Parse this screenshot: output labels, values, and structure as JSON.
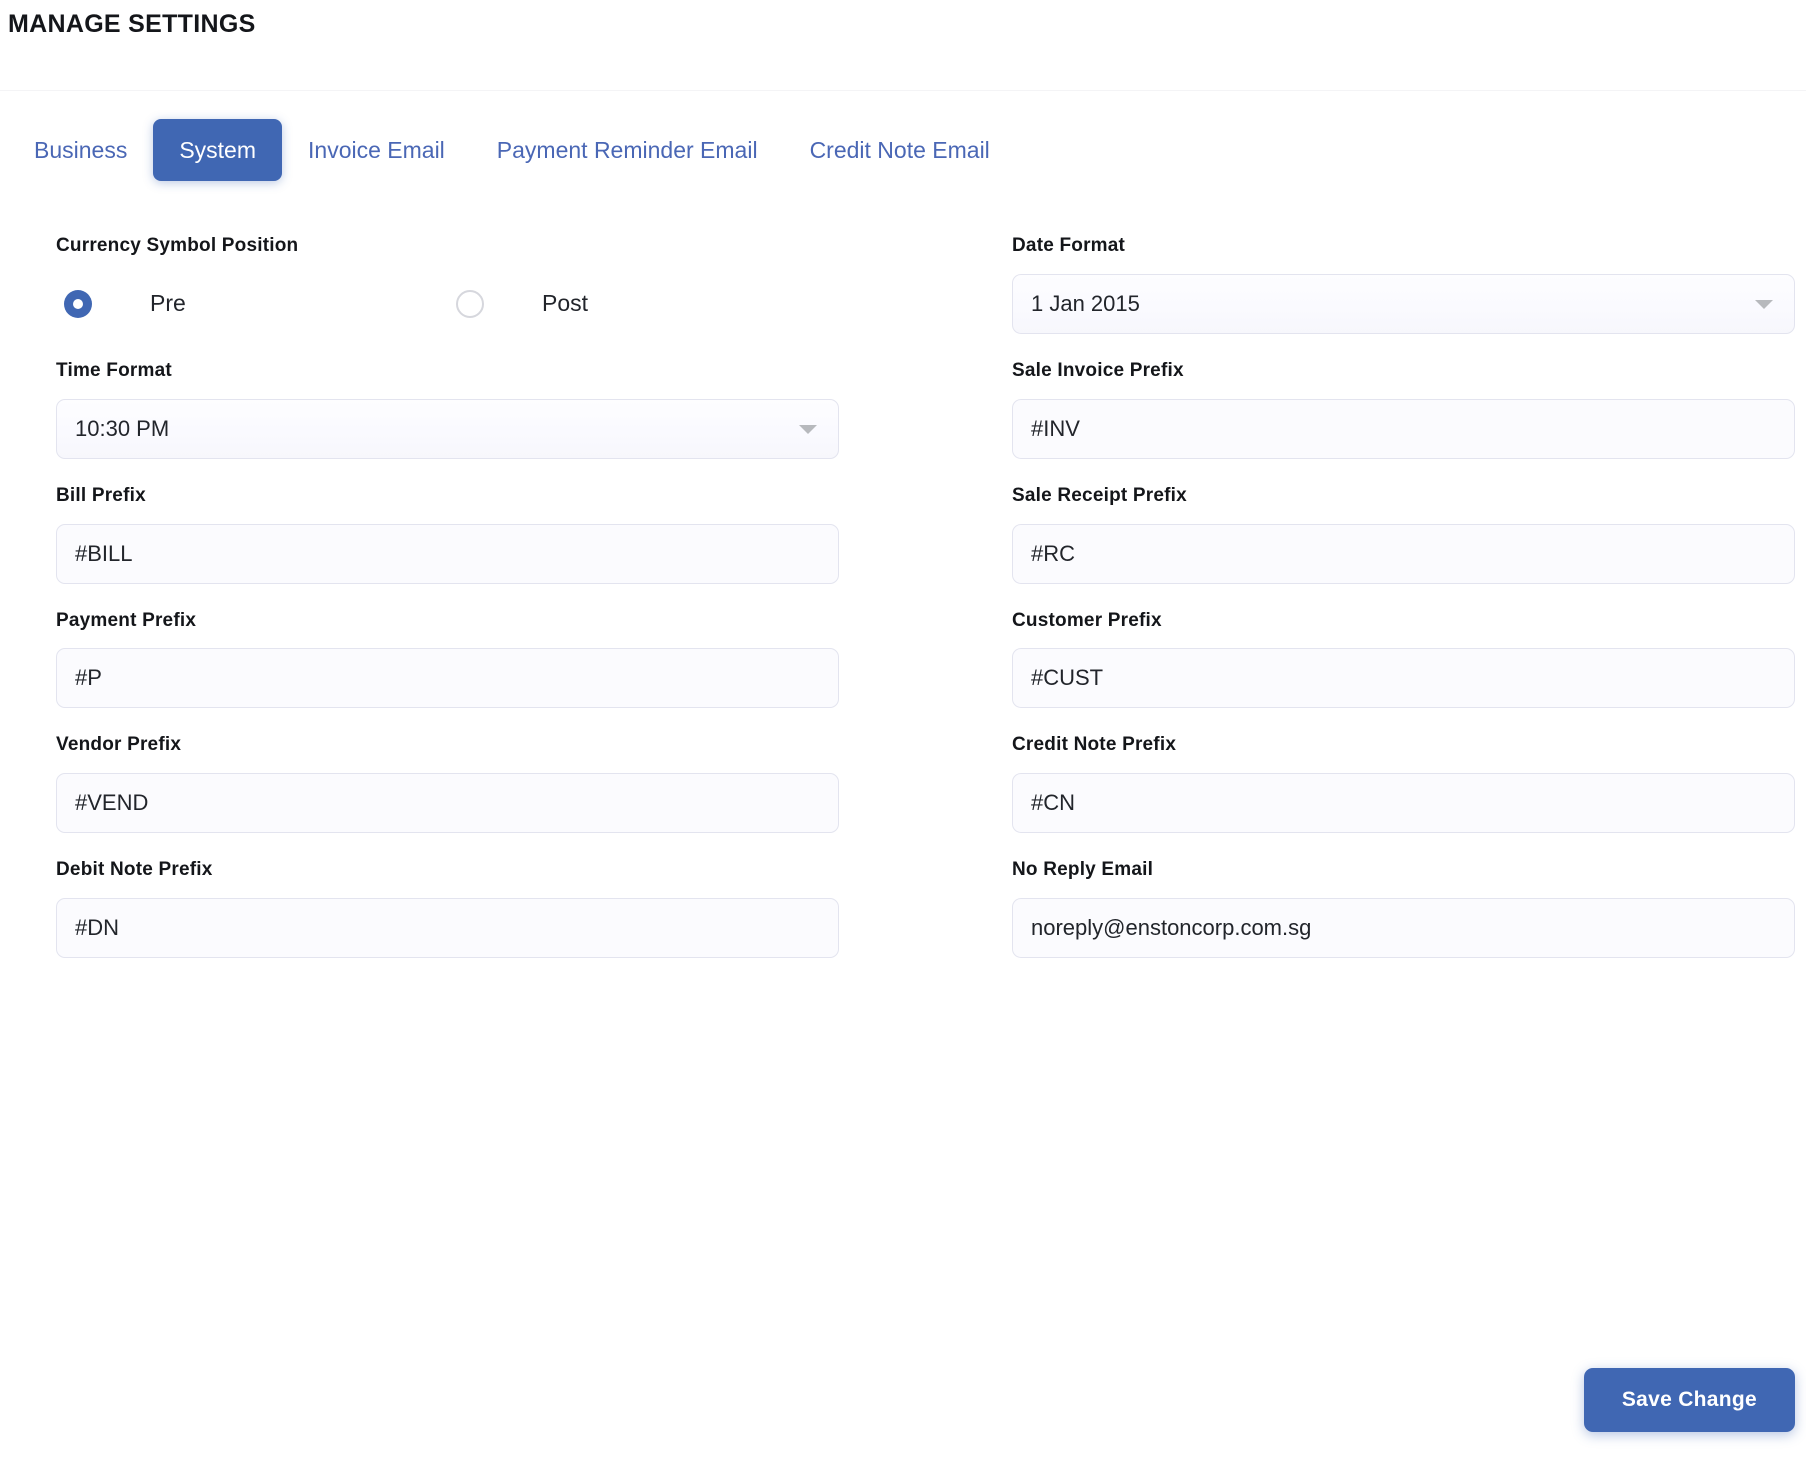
{
  "header": {
    "title": "MANAGE SETTINGS"
  },
  "tabs": [
    {
      "label": "Business",
      "active": false
    },
    {
      "label": "System",
      "active": true
    },
    {
      "label": "Invoice Email",
      "active": false
    },
    {
      "label": "Payment Reminder Email",
      "active": false
    },
    {
      "label": "Credit Note Email",
      "active": false
    }
  ],
  "form": {
    "currency_symbol_position": {
      "label": "Currency Symbol Position",
      "options": [
        {
          "label": "Pre",
          "selected": true
        },
        {
          "label": "Post",
          "selected": false
        }
      ]
    },
    "date_format": {
      "label": "Date Format",
      "value": "1 Jan 2015"
    },
    "time_format": {
      "label": "Time Format",
      "value": "10:30 PM"
    },
    "sale_invoice_prefix": {
      "label": "Sale Invoice Prefix",
      "value": "#INV"
    },
    "bill_prefix": {
      "label": "Bill Prefix",
      "value": "#BILL"
    },
    "sale_receipt_prefix": {
      "label": "Sale Receipt Prefix",
      "value": "#RC"
    },
    "payment_prefix": {
      "label": "Payment Prefix",
      "value": "#P"
    },
    "customer_prefix": {
      "label": "Customer Prefix",
      "value": "#CUST"
    },
    "vendor_prefix": {
      "label": "Vendor Prefix",
      "value": "#VEND"
    },
    "credit_note_prefix": {
      "label": "Credit Note Prefix",
      "value": "#CN"
    },
    "debit_note_prefix": {
      "label": "Debit Note Prefix",
      "value": "#DN"
    },
    "no_reply_email": {
      "label": "No Reply Email",
      "value": "noreply@enstoncorp.com.sg"
    }
  },
  "footer": {
    "save_label": "Save Change"
  },
  "colors": {
    "accent": "#4067b3",
    "link": "#4a67b5",
    "text": "#14161a",
    "field_bg": "#fbfbfe",
    "field_border": "#e3e4ef"
  }
}
